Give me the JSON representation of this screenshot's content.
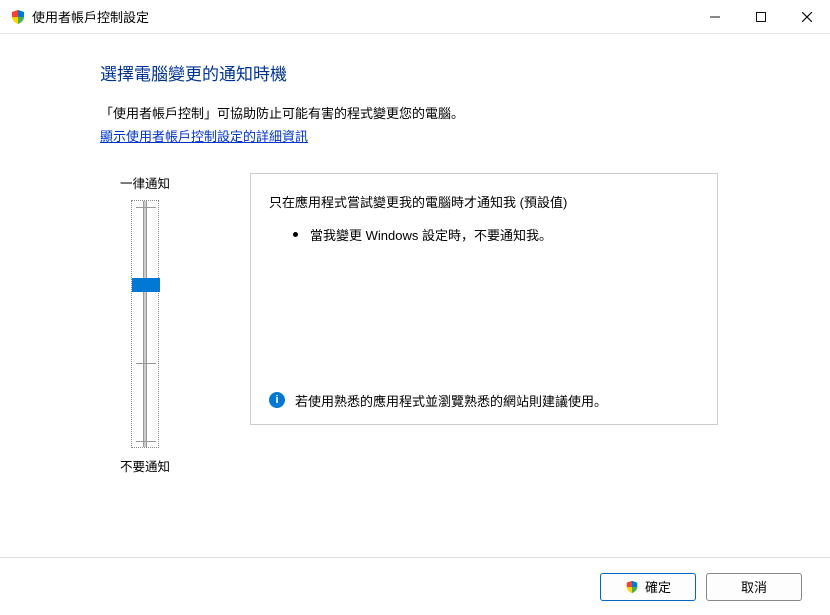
{
  "titlebar": {
    "title": "使用者帳戶控制設定"
  },
  "page": {
    "heading": "選擇電腦變更的通知時機",
    "subtitle": "「使用者帳戶控制」可協助防止可能有害的程式變更您的電腦。",
    "link": "顯示使用者帳戶控制設定的詳細資訊"
  },
  "slider": {
    "top_label": "一律通知",
    "bottom_label": "不要通知",
    "level": 2,
    "levels": 4
  },
  "description": {
    "title": "只在應用程式嘗試變更我的電腦時才通知我 (預設值)",
    "bullet": "當我變更 Windows 設定時，不要通知我。",
    "recommendation": "若使用熟悉的應用程式並瀏覽熟悉的網站則建議使用。"
  },
  "footer": {
    "ok": "確定",
    "cancel": "取消"
  }
}
